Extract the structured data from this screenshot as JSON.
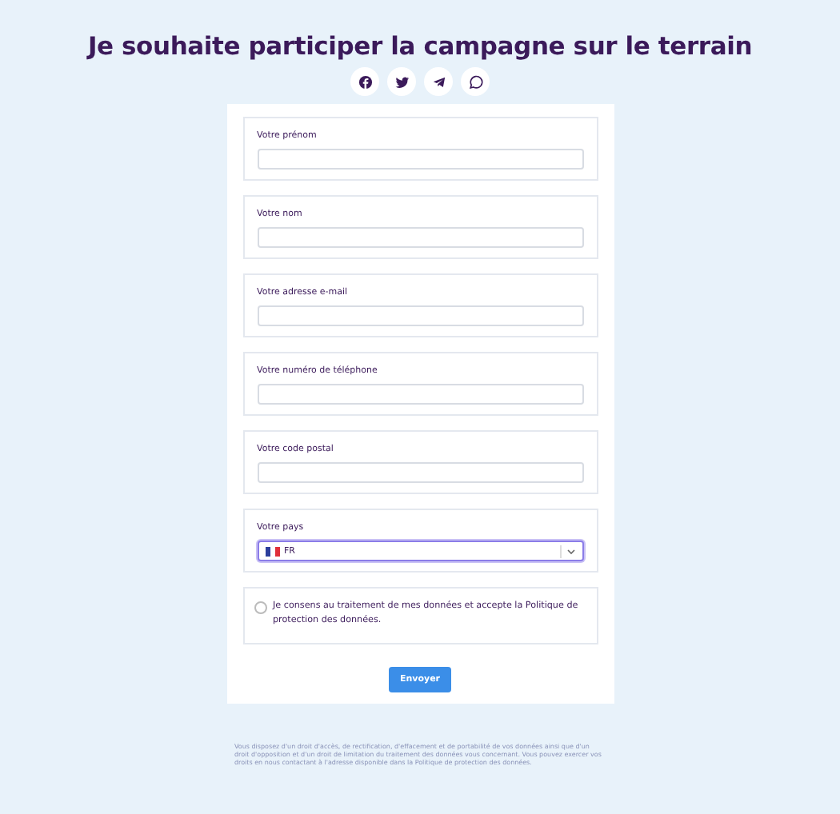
{
  "title": "Je souhaite participer la campagne sur le terrain",
  "share_icons": [
    {
      "kind": "facebook"
    },
    {
      "kind": "twitter"
    },
    {
      "kind": "telegram"
    },
    {
      "kind": "whatsapp"
    }
  ],
  "fields": [
    {
      "kind": "text",
      "label": "Votre prénom"
    },
    {
      "kind": "text",
      "label": "Votre nom"
    },
    {
      "kind": "text",
      "label": "Votre adresse e-mail"
    },
    {
      "kind": "text",
      "label": "Votre numéro de téléphone"
    },
    {
      "kind": "text",
      "label": "Votre code postal"
    },
    {
      "kind": "country",
      "label": "Votre pays",
      "value": "FR",
      "focused": true
    },
    {
      "kind": "consent",
      "label": "Je consens au traitement de mes données et accepte la Politique de protection des données.",
      "checked": false
    }
  ],
  "submit": "Envoyer",
  "footer": "Vous disposez d'un droit d'accès, de rectification, d'effacement et de portabilité de vos données ainsi que d'un droit d'opposition et d'un droit de limitation du traitement des données vous concernant. Vous pouvez exercer vos droits en nous contactant à l'adresse disponible dans la Politique de protection des données."
}
